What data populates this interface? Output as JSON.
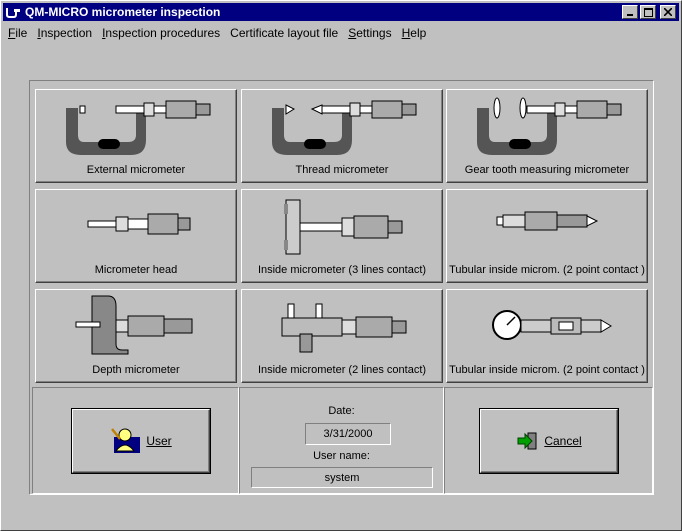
{
  "window": {
    "title": "QM-MICRO micrometer inspection"
  },
  "menu": [
    {
      "label": "File",
      "accel": "F",
      "rest": "ile"
    },
    {
      "label": "Inspection",
      "accel": "I",
      "rest": "nspection"
    },
    {
      "label": "Inspection procedures",
      "accel": "I",
      "rest": "nspection procedures"
    },
    {
      "label": "Certificate layout file",
      "accel": "",
      "rest": "Certificate layout file"
    },
    {
      "label": "Settings",
      "accel": "S",
      "rest": "ettings"
    },
    {
      "label": "Help",
      "accel": "H",
      "rest": "elp"
    }
  ],
  "instruments": [
    "External micrometer",
    "Thread micrometer",
    "Gear tooth measuring micrometer",
    "Micrometer head",
    "Inside micrometer (3 lines contact)",
    "Tubular inside microm. (2 point contact )",
    "Depth micrometer",
    "Inside micrometer (2 lines contact)",
    "Tubular inside microm. (2 point contact )"
  ],
  "footer": {
    "user_button": "User",
    "date_label": "Date:",
    "date_value": "3/31/2000",
    "username_label": "User name:",
    "username_value": "system",
    "cancel_button": "Cancel"
  },
  "icons": {
    "app": "micrometer-app-icon",
    "user": "user-pencil-icon",
    "cancel": "exit-arrow-icon"
  }
}
